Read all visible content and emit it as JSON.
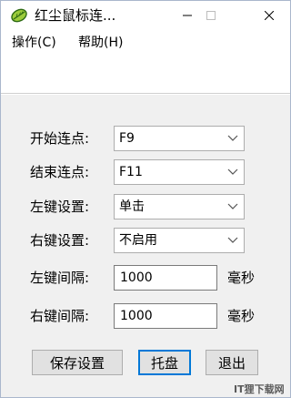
{
  "window": {
    "title": "红尘鼠标连...",
    "icon": "green-leaf-icon"
  },
  "menu": {
    "items": [
      {
        "label": "操作(C)"
      },
      {
        "label": "帮助(H)"
      }
    ]
  },
  "form": {
    "rows": [
      {
        "label": "开始连点:",
        "value": "F9",
        "type": "select"
      },
      {
        "label": "结束连点:",
        "value": "F11",
        "type": "select"
      },
      {
        "label": "左键设置:",
        "value": "单击",
        "type": "select"
      },
      {
        "label": "右键设置:",
        "value": "不启用",
        "type": "select"
      },
      {
        "label": "左键间隔:",
        "value": "1000",
        "type": "input",
        "unit": "毫秒"
      },
      {
        "label": "右键间隔:",
        "value": "1000",
        "type": "input",
        "unit": "毫秒"
      }
    ]
  },
  "buttons": {
    "save": "保存设置",
    "tray": "托盘",
    "exit": "退出"
  },
  "watermark": "IT狸下载网",
  "colors": {
    "client_bg": "#f0f0f0",
    "focus_border": "#0078d7",
    "button_bg": "#e1e1e1"
  }
}
